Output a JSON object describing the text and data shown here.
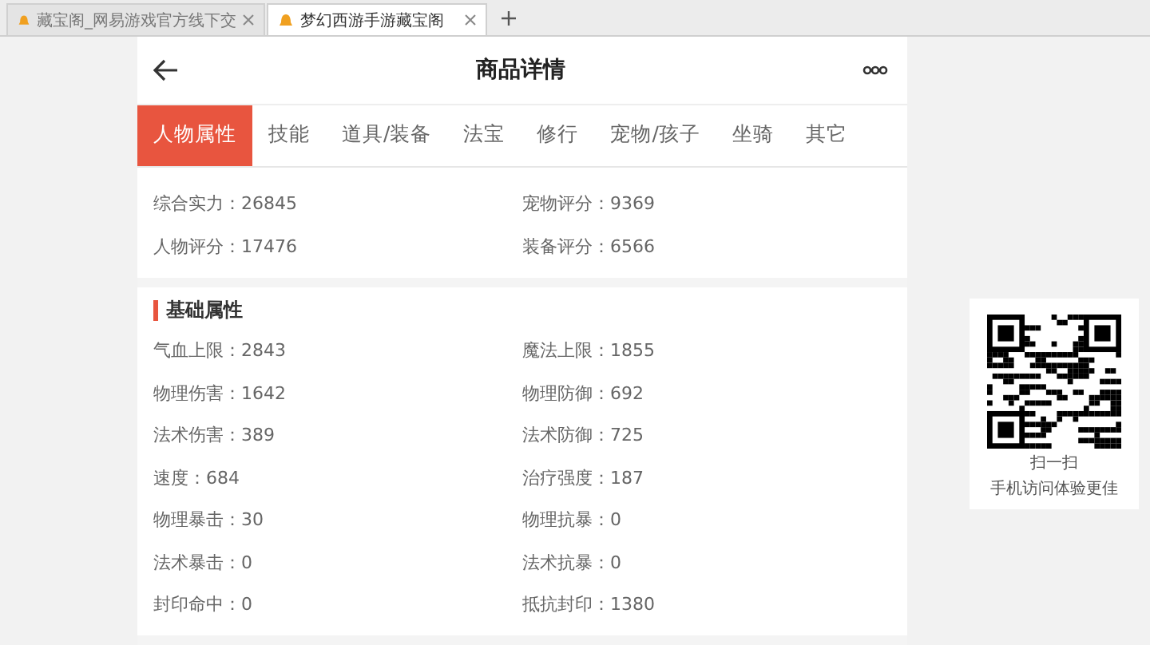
{
  "browser_tabs": [
    {
      "title": "藏宝阁_网易游戏官方线下交",
      "selected": false
    },
    {
      "title": "梦幻西游手游藏宝阁",
      "selected": true
    }
  ],
  "header": {
    "title": "商品详情"
  },
  "tabs": [
    {
      "label": "人物属性",
      "selected": true
    },
    {
      "label": "技能",
      "selected": false
    },
    {
      "label": "道具/装备",
      "selected": false
    },
    {
      "label": "法宝",
      "selected": false
    },
    {
      "label": "修行",
      "selected": false
    },
    {
      "label": "宠物/孩子",
      "selected": false
    },
    {
      "label": "坐骑",
      "selected": false
    },
    {
      "label": "其它",
      "selected": false
    }
  ],
  "sections": [
    {
      "rows": [
        [
          "综合实力：26845",
          "宠物评分：9369"
        ],
        [
          "人物评分：17476",
          "装备评分：6566"
        ]
      ]
    },
    {
      "title": "基础属性",
      "rows": [
        [
          "气血上限：2843",
          "魔法上限：1855"
        ],
        [
          "物理伤害：1642",
          "物理防御：692"
        ],
        [
          "法术伤害：389",
          "法术防御：725"
        ],
        [
          "速度：684",
          "治疗强度：187"
        ],
        [
          "物理暴击：30",
          "物理抗暴：0"
        ],
        [
          "法术暴击：0",
          "法术抗暴：0"
        ],
        [
          "封印命中：0",
          "抵抗封印：1380"
        ]
      ]
    }
  ],
  "qr_panel": {
    "caption": "扫一扫",
    "subcaption": "手机访问体验更佳"
  }
}
